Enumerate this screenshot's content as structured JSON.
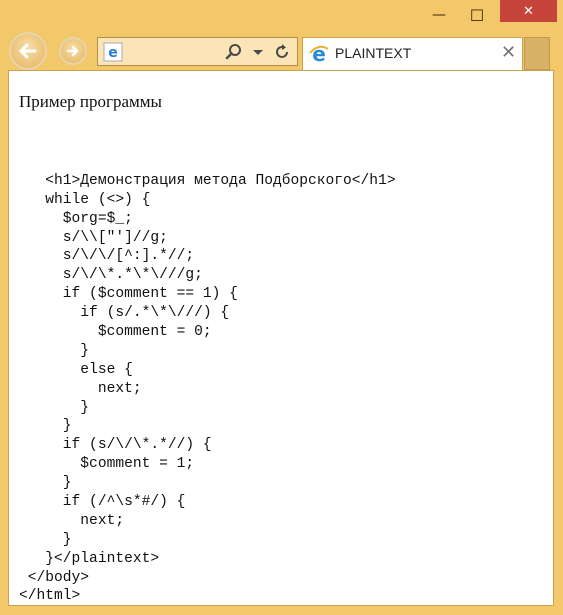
{
  "window": {
    "minimize_glyph": "—",
    "maximize_glyph": "☐",
    "close_glyph": "✕"
  },
  "toolbar": {
    "back_icon": "back-arrow-icon",
    "forward_icon": "forward-arrow-icon",
    "address_icons": [
      "ie-logo-icon",
      "search-icon",
      "dropdown-icon",
      "refresh-icon"
    ]
  },
  "tab": {
    "title": "PLAINTEXT",
    "close_glyph": "✕"
  },
  "page": {
    "heading": "Пример программы",
    "code_lines": [
      "",
      "   <h1>Демонстрация метода Подборского</h1>",
      "   while (<>) {",
      "     $org=$_;",
      "     s/\\\\[\"']//g;",
      "     s/\\/\\/[^:].*//;",
      "     s/\\/\\*.*\\*\\///g;",
      "     if ($comment == 1) {",
      "       if (s/.*\\*\\///) {",
      "         $comment = 0;",
      "       }",
      "       else {",
      "         next;",
      "       }",
      "     }",
      "     if (s/\\/\\*.*//) {",
      "       $comment = 1;",
      "     }",
      "     if (/^\\s*#/) {",
      "       next;",
      "     }",
      "   }</plaintext>",
      " </body>",
      "</html>"
    ]
  },
  "colors": {
    "frame": "#f2c86b",
    "close_button": "#c7443b",
    "content_background": "#ffffff"
  }
}
